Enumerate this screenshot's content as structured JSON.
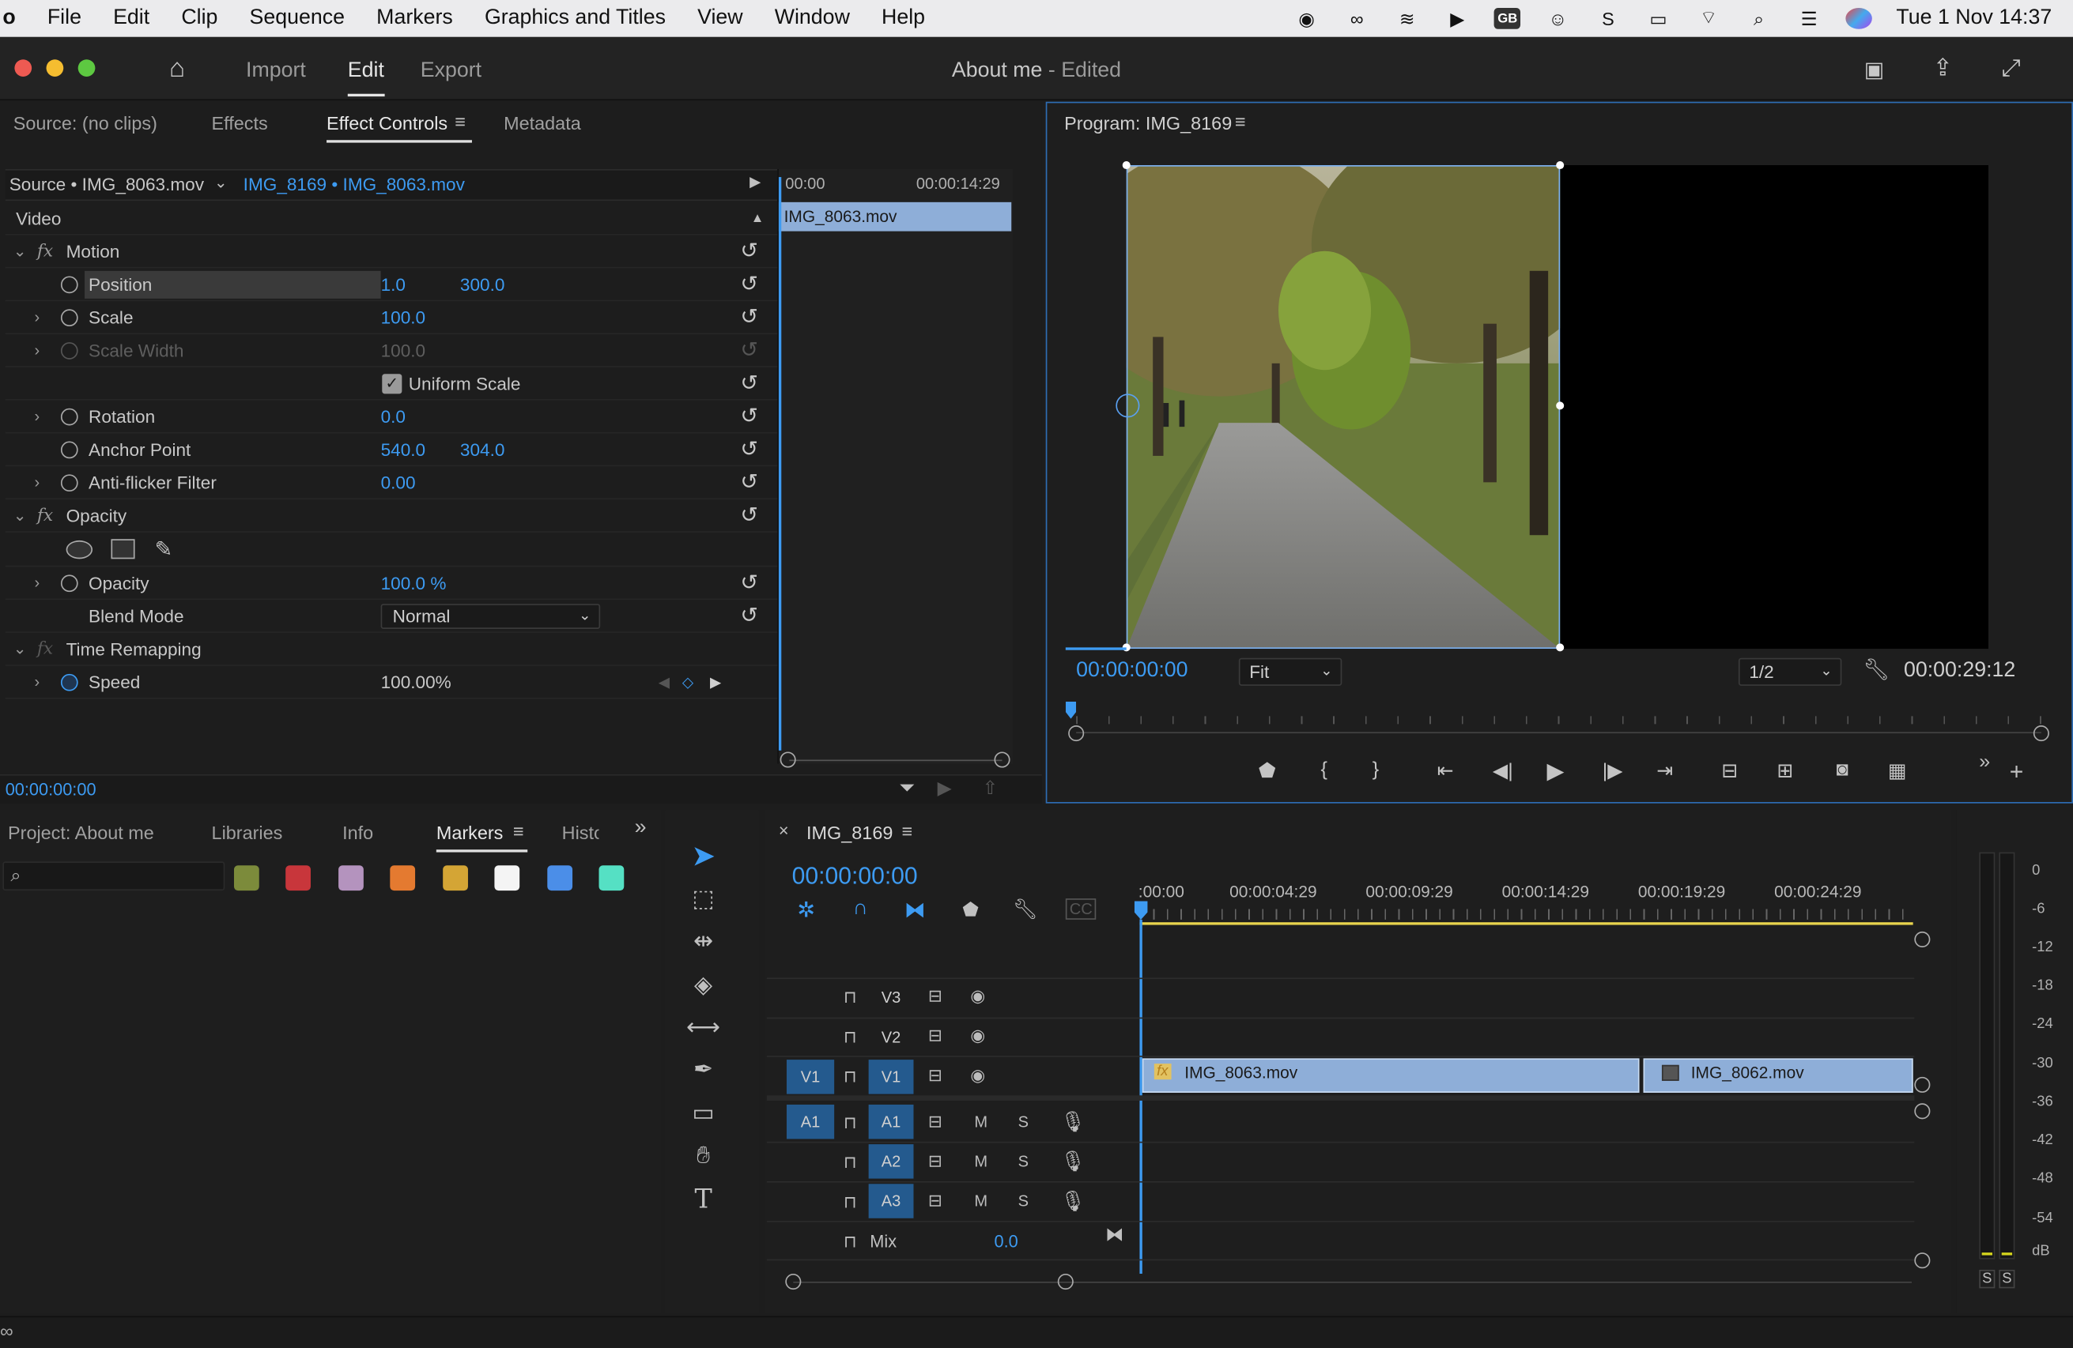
{
  "menubar": {
    "app": "o",
    "items": [
      "File",
      "Edit",
      "Clip",
      "Sequence",
      "Markers",
      "Graphics and Titles",
      "View",
      "Window",
      "Help"
    ],
    "clock": "Tue 1 Nov  14:37",
    "gb_label": "GB"
  },
  "titlebar": {
    "workspaces": [
      "Import",
      "Edit",
      "Export"
    ],
    "active_workspace": "Edit",
    "doc_name": "About me",
    "doc_state": " - Edited"
  },
  "source_panel": {
    "tabs": [
      "Source: (no clips)",
      "Effects",
      "Effect Controls",
      "Metadata"
    ],
    "active_tab": "Effect Controls",
    "source_clip": "Source • IMG_8063.mov",
    "sequence_clip": "IMG_8169 • IMG_8063.mov",
    "mini_ruler_start": "00:00",
    "mini_ruler_end": "00:00:14:29",
    "mini_clip": "IMG_8063.mov",
    "section": "Video",
    "motion_label": "Motion",
    "position": {
      "label": "Position",
      "x": "1.0",
      "y": "300.0"
    },
    "scale": {
      "label": "Scale",
      "value": "100.0"
    },
    "scale_width": {
      "label": "Scale Width",
      "value": "100.0"
    },
    "uniform_scale": "Uniform Scale",
    "rotation": {
      "label": "Rotation",
      "value": "0.0"
    },
    "anchor": {
      "label": "Anchor Point",
      "x": "540.0",
      "y": "304.0"
    },
    "antiflicker": {
      "label": "Anti-flicker Filter",
      "value": "0.00"
    },
    "opacity_label": "Opacity",
    "opacity": {
      "label": "Opacity",
      "value": "100.0 %"
    },
    "blend": {
      "label": "Blend Mode",
      "value": "Normal"
    },
    "time_remap": "Time Remapping",
    "speed": {
      "label": "Speed",
      "value": "100.00%"
    },
    "timecode": "00:00:00:00"
  },
  "program_monitor": {
    "title": "Program: IMG_8169",
    "timecode": "00:00:00:00",
    "zoom": "Fit",
    "resolution": "1/2",
    "duration": "00:00:29:12"
  },
  "project_panel": {
    "tabs": [
      "Project: About me",
      "Libraries",
      "Info",
      "Markers",
      "Histo"
    ],
    "active_tab": "Markers",
    "search_placeholder": "",
    "swatch_colors": [
      "#7c8b3b",
      "#c8363b",
      "#b493be",
      "#e47a30",
      "#d4a535",
      "#f4f4f4",
      "#4b8ee8",
      "#55e0c4"
    ]
  },
  "timeline": {
    "sequence": "IMG_8169",
    "timecode": "00:00:00:00",
    "ruler": [
      ":00:00",
      "00:00:04:29",
      "00:00:09:29",
      "00:00:14:29",
      "00:00:19:29",
      "00:00:24:29"
    ],
    "video_tracks": [
      "V3",
      "V2",
      "V1"
    ],
    "audio_tracks": [
      "A1",
      "A2",
      "A3"
    ],
    "source_v": "V1",
    "source_a": "A1",
    "mix_label": "Mix",
    "mix_value": "0.0",
    "clip1": "IMG_8063.mov",
    "clip2": "IMG_8062.mov",
    "mute": "M",
    "solo": "S"
  },
  "audio_meter": {
    "labels": [
      "0",
      "-6",
      "-12",
      "-18",
      "-24",
      "-30",
      "-36",
      "-42",
      "-48",
      "-54",
      "dB"
    ],
    "solo_left": "S",
    "solo_right": "S"
  },
  "colors": {
    "accent": "#3d9bf2",
    "clip": "#8eaed8",
    "panel": "#1e1e1e"
  }
}
